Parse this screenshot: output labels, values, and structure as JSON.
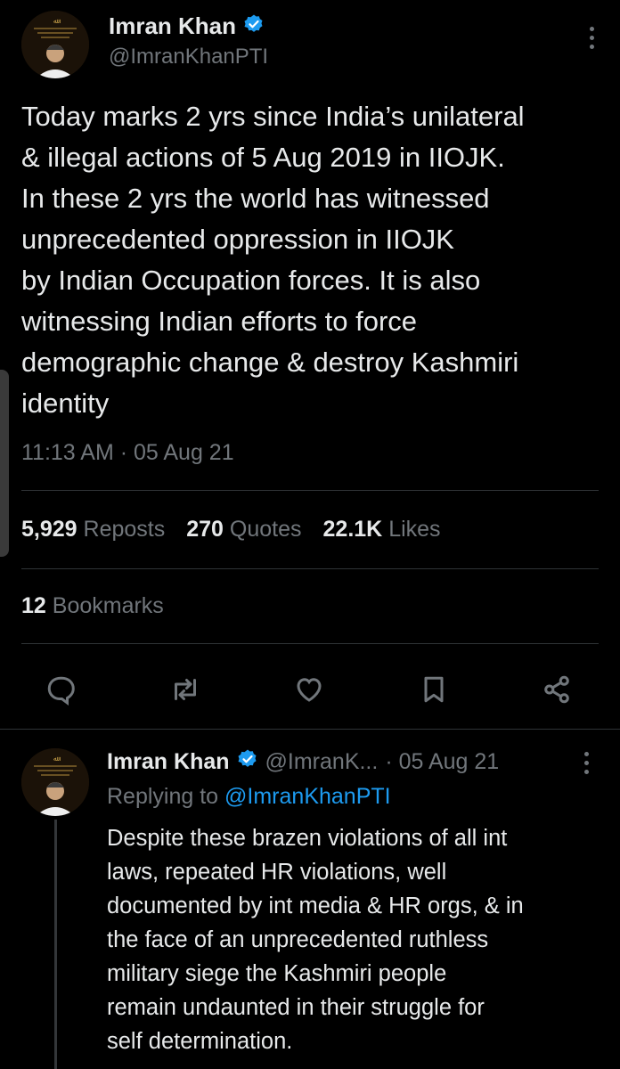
{
  "tweet": {
    "author_name": "Imran Khan",
    "author_handle": "@ImranKhanPTI",
    "text": "Today marks 2 yrs since India’s unilateral\n& illegal actions of 5 Aug 2019 in IIOJK.\nIn these 2 yrs the world has witnessed\nunprecedented oppression in IIOJK\nby Indian Occupation forces. It is also\nwitnessing Indian efforts to force\ndemographic change & destroy Kashmiri\nidentity",
    "timestamp": "11:13 AM · 05 Aug 21",
    "stats": {
      "reposts_count": "5,929",
      "reposts_label": "Reposts",
      "quotes_count": "270",
      "quotes_label": "Quotes",
      "likes_count": "22.1K",
      "likes_label": "Likes",
      "bookmarks_count": "12",
      "bookmarks_label": "Bookmarks"
    },
    "actions": [
      "reply-icon",
      "repost-icon",
      "like-icon",
      "bookmark-icon",
      "share-icon"
    ]
  },
  "reply": {
    "author_name": "Imran Khan",
    "author_handle": "@ImranK...",
    "date": "· 05 Aug 21",
    "replying_prefix": "Replying to",
    "replying_handle": "@ImranKhanPTI",
    "text": "Despite these brazen violations of all int\nlaws, repeated HR violations, well\ndocumented by int media & HR orgs, & in\nthe face of an unprecedented  ruthless\nmilitary siege the Kashmiri people\nremain undaunted in their struggle for\nself determination."
  },
  "colors": {
    "background": "#000000",
    "text": "#e7e9ea",
    "muted": "#71767b",
    "accent": "#1d9bf0",
    "divider": "#2f3336"
  }
}
